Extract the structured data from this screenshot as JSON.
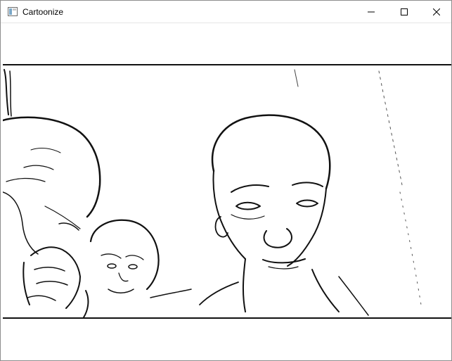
{
  "window": {
    "title": "Cartoonize",
    "icon": "app-window-icon",
    "controls": [
      "minimize-icon",
      "maximize-icon",
      "close-icon"
    ]
  },
  "canvas": {
    "content": "cartoon-edge-render",
    "line_color": "#111111",
    "background": "#ffffff"
  }
}
